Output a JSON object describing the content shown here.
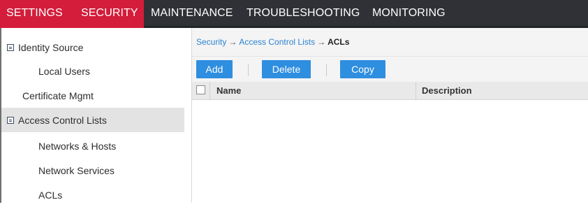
{
  "topnav": {
    "items": [
      "SETTINGS",
      "SECURITY",
      "MAINTENANCE",
      "TROUBLESHOOTING",
      "MONITORING"
    ],
    "active": "SECURITY",
    "accent_color": "#d31d3a",
    "bar_color": "#2f3136"
  },
  "sidebar": {
    "items": [
      {
        "label": "Identity Source",
        "icon": "collapse-tree-icon"
      },
      {
        "label": "Local Users"
      },
      {
        "label": "Certificate Mgmt"
      },
      {
        "label": "Access Control Lists",
        "icon": "collapse-tree-icon",
        "selected": true
      },
      {
        "label": "Networks & Hosts"
      },
      {
        "label": "Network Services"
      },
      {
        "label": "ACLs"
      }
    ]
  },
  "breadcrumb": {
    "items": [
      "Security",
      "Access Control Lists",
      "ACLs"
    ],
    "separator": "→"
  },
  "toolbar": {
    "add_label": "Add",
    "delete_label": "Delete",
    "copy_label": "Copy",
    "button_color": "#2e8ee0"
  },
  "grid": {
    "columns": [
      "Name",
      "Description"
    ],
    "rows": []
  }
}
